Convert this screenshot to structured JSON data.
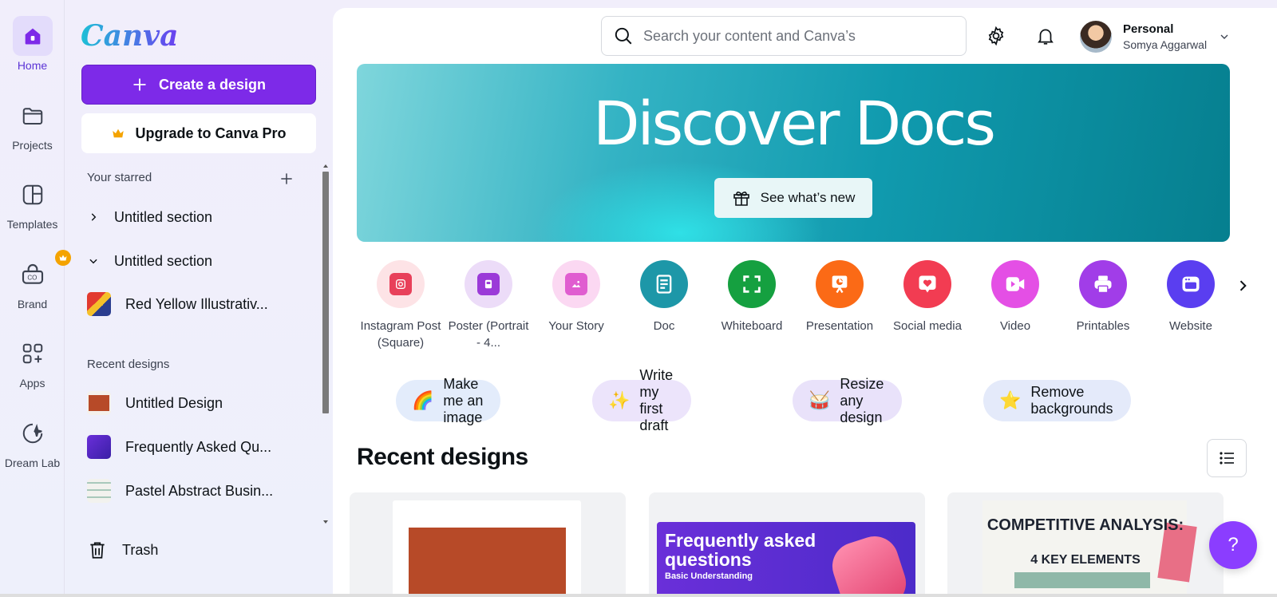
{
  "rail": [
    {
      "label": "Home",
      "icon": "home-icon",
      "active": true
    },
    {
      "label": "Projects",
      "icon": "folder-icon"
    },
    {
      "label": "Templates",
      "icon": "templates-icon"
    },
    {
      "label": "Brand",
      "icon": "brand-icon"
    },
    {
      "label": "Apps",
      "icon": "apps-icon"
    },
    {
      "label": "Dream Lab",
      "icon": "dream-lab-icon"
    }
  ],
  "sidebar": {
    "logo": "Canva",
    "create_label": "Create a design",
    "upgrade_label": "Upgrade to Canva Pro",
    "starred_heading": "Your starred",
    "starred": [
      {
        "label": "Untitled section",
        "state": "collapsed"
      },
      {
        "label": "Untitled section",
        "state": "expanded"
      },
      {
        "label": "Red Yellow Illustrativ..."
      }
    ],
    "recent_heading": "Recent designs",
    "recent": [
      {
        "label": "Untitled Design",
        "thumb_color": "#b74a28"
      },
      {
        "label": "Frequently Asked Qu...",
        "thumb_color": "#5b2fd0"
      },
      {
        "label": "Pastel Abstract Busin...",
        "thumb_color": "#dfe6e2"
      }
    ],
    "trash_label": "Trash"
  },
  "topbar": {
    "search_placeholder": "Search your content and Canva’s",
    "account_type": "Personal",
    "account_name": "Somya Aggarwal"
  },
  "banner": {
    "title": "Discover Docs",
    "button_label": "See what’s new"
  },
  "design_types": [
    {
      "label": "Instagram Post (Square)",
      "icon": "instagram-icon",
      "bg": "#fde3e6",
      "fg": "#e8405a"
    },
    {
      "label": "Poster (Portrait - 4...",
      "icon": "poster-icon",
      "bg": "#ecdcf8",
      "fg": "#9b3ad8"
    },
    {
      "label": "Your Story",
      "icon": "story-icon",
      "bg": "#fbd8f2",
      "fg": "#e05dd0"
    },
    {
      "label": "Doc",
      "icon": "doc-icon",
      "bg": "#1d97a8",
      "fg": "#ffffff"
    },
    {
      "label": "Whiteboard",
      "icon": "whiteboard-icon",
      "bg": "#15a040",
      "fg": "#ffffff"
    },
    {
      "label": "Presentation",
      "icon": "presentation-icon",
      "bg": "#fb6a16",
      "fg": "#ffffff"
    },
    {
      "label": "Social media",
      "icon": "social-media-icon",
      "bg": "#f23c52",
      "fg": "#ffffff"
    },
    {
      "label": "Video",
      "icon": "video-icon",
      "bg": "#e44fe5",
      "fg": "#ffffff"
    },
    {
      "label": "Printables",
      "icon": "printables-icon",
      "bg": "#a13de8",
      "fg": "#ffffff"
    },
    {
      "label": "Website",
      "icon": "website-icon",
      "bg": "#5a3ef0",
      "fg": "#ffffff"
    }
  ],
  "chips": [
    {
      "label": "Make me an image",
      "emoji": "🌈",
      "bg": "#e3ecfb"
    },
    {
      "label": "Write my first draft",
      "emoji": "✨",
      "bg": "#ece4fb"
    },
    {
      "label": "Resize any design",
      "emoji": "🥁",
      "bg": "#e9e2fa"
    },
    {
      "label": "Remove backgrounds",
      "emoji": "⭐",
      "bg": "#e4eafa"
    }
  ],
  "recent": {
    "title": "Recent designs",
    "cards": [
      {
        "title": ""
      },
      {
        "title": "Frequently asked questions",
        "subtitle": "Basic Understanding"
      },
      {
        "title": "COMPETITIVE ANALYSIS:",
        "subtitle": "4 KEY ELEMENTS"
      }
    ]
  },
  "help_label": "?",
  "colors": {
    "accent": "#7d2ae8",
    "banner": "#109aae"
  }
}
